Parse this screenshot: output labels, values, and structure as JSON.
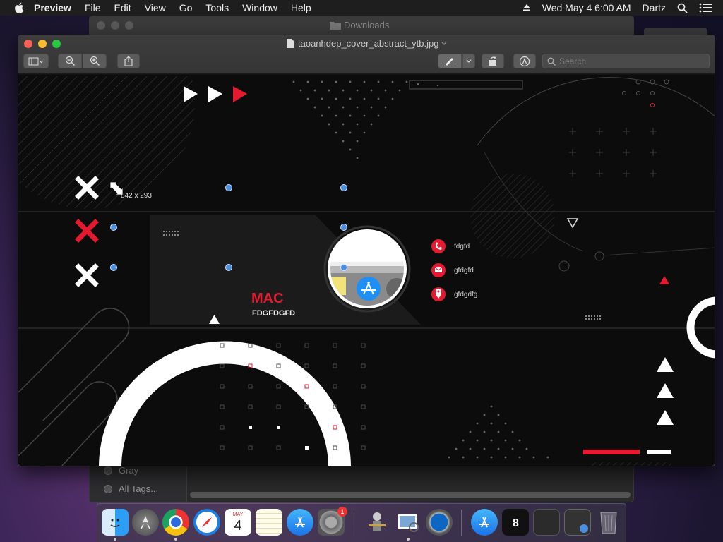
{
  "menubar": {
    "app_name": "Preview",
    "items": [
      "File",
      "Edit",
      "View",
      "Go",
      "Tools",
      "Window",
      "Help"
    ],
    "datetime": "Wed May 4  6:00 AM",
    "user": "Dartz"
  },
  "finder": {
    "title": "Downloads",
    "tags": [
      "Gray",
      "All Tags..."
    ]
  },
  "preview": {
    "filename": "taoanhdep_cover_abstract_ytb.jpg",
    "search_placeholder": "Search",
    "selection_size": "842 x 293",
    "card_title": "MAC",
    "card_subtitle": "FDGFDGFD",
    "contacts": [
      "fdgfd",
      "gfdgfd",
      "gfdgdfg"
    ]
  },
  "dock": {
    "apps": [
      "Finder",
      "Launchpad",
      "Google Chrome",
      "Safari",
      "Calendar",
      "Notes",
      "App Store",
      "System Preferences",
      "Automator",
      "Preview",
      "QuickTime Player",
      "App Store",
      "Terminal",
      "Screenshot",
      "Documents",
      "Trash"
    ],
    "calendar_month": "MAY",
    "calendar_day": "4",
    "prefs_badge": "1"
  },
  "colors": {
    "accent_red": "#e5192f",
    "selection_handle": "#4a8fe0"
  }
}
